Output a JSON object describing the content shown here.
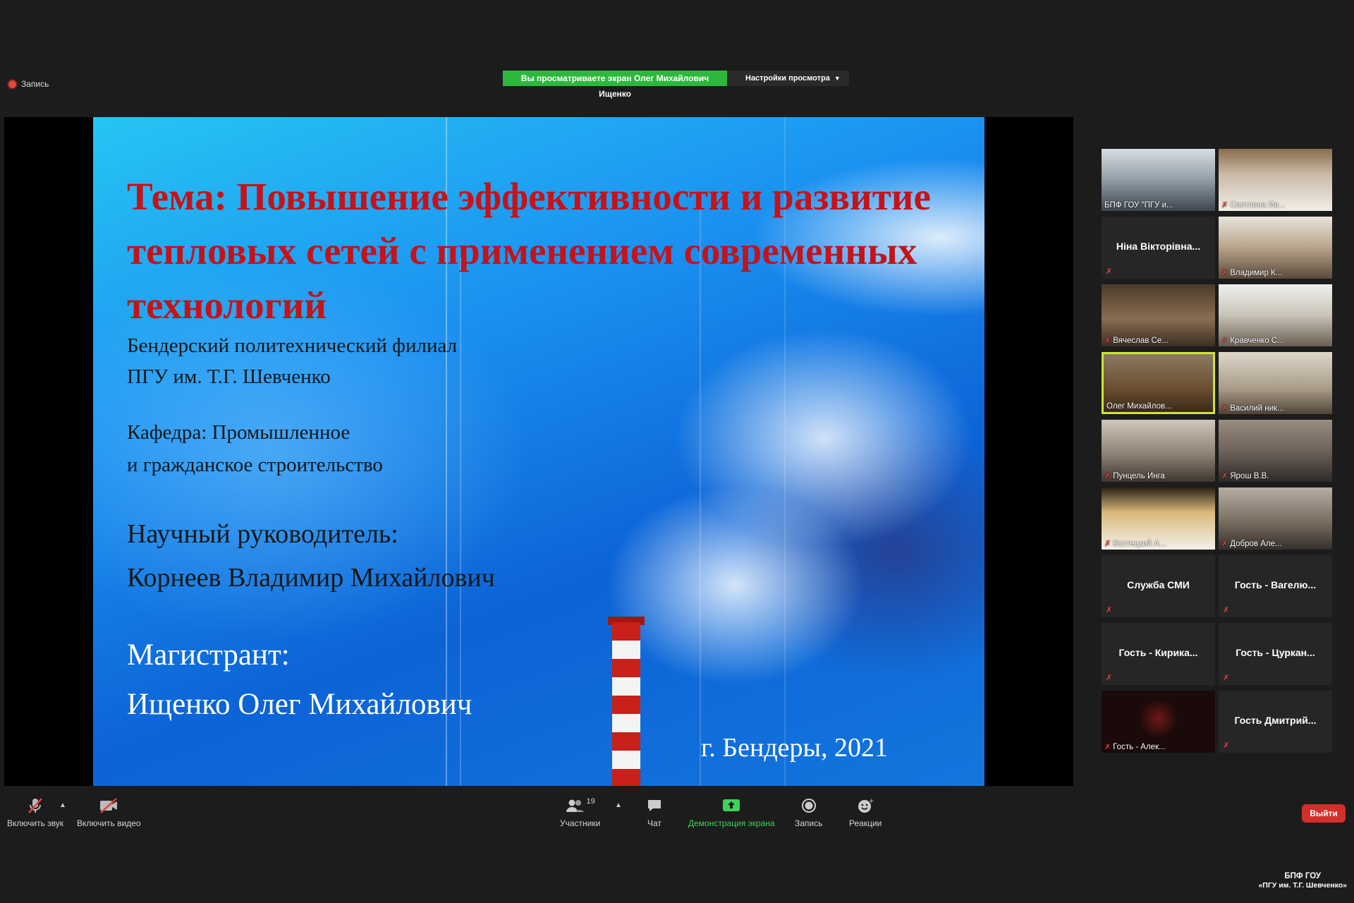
{
  "recording": {
    "label": "Запись"
  },
  "share_banner": {
    "text": "Вы просматриваете экран Олег Михайлович Ищенко",
    "view_options": "Настройки просмотра"
  },
  "slide": {
    "title": "Тема: Повышение эффективности и развитие тепловых сетей с применением современных технологий",
    "branch_line1": "Бендерский политехнический филиал",
    "branch_line2": "ПГУ им. Т.Г. Шевченко",
    "dept_line1": "Кафедра: Промышленное",
    "dept_line2": "и гражданское строительство",
    "supervisor_label": "Научный руководитель:",
    "supervisor_name": "Корнеев Владимир Михайлович",
    "author_label": "Магистрант:",
    "author_name": "Ищенко Олег Михайлович",
    "city_year": "г. Бендеры, 2021"
  },
  "participants": [
    {
      "name": "БПФ ГОУ \"ПГУ и...",
      "video": true,
      "muted": false,
      "active": false
    },
    {
      "name": "Светлана Ив...",
      "video": true,
      "muted": true,
      "active": false
    },
    {
      "name": "Ніна Вікторівна...",
      "video": false,
      "muted": true,
      "active": false
    },
    {
      "name": "Владимир К...",
      "video": true,
      "muted": true,
      "active": false
    },
    {
      "name": "Вячеслав Се...",
      "video": true,
      "muted": true,
      "active": false
    },
    {
      "name": "Кравченко С...",
      "video": true,
      "muted": true,
      "active": false
    },
    {
      "name": "Олег Михайлов...",
      "video": true,
      "muted": false,
      "active": true
    },
    {
      "name": "Василий ник...",
      "video": true,
      "muted": true,
      "active": false
    },
    {
      "name": "Пунцель Инга",
      "video": true,
      "muted": true,
      "active": false
    },
    {
      "name": "Ярош В.В.",
      "video": true,
      "muted": true,
      "active": false
    },
    {
      "name": "Костецкий А...",
      "video": true,
      "muted": true,
      "active": false
    },
    {
      "name": "Добров Але...",
      "video": true,
      "muted": true,
      "active": false
    },
    {
      "name": "Служба СМИ",
      "video": false,
      "muted": true,
      "active": false
    },
    {
      "name": "Гость - Вагелю...",
      "video": false,
      "muted": true,
      "active": false
    },
    {
      "name": "Гость - Кирика...",
      "video": false,
      "muted": true,
      "active": false
    },
    {
      "name": "Гость - Цуркан...",
      "video": false,
      "muted": true,
      "active": false
    },
    {
      "name": "Гость - Алек...",
      "video": true,
      "muted": true,
      "active": false
    },
    {
      "name": "Гость Дмитрий...",
      "video": false,
      "muted": true,
      "active": false
    }
  ],
  "toolbar": {
    "unmute": "Включить звук",
    "start_video": "Включить видео",
    "participants": "Участники",
    "participants_count": "19",
    "chat": "Чат",
    "share_screen": "Демонстрация экрана",
    "record": "Запись",
    "reactions": "Реакции",
    "leave": "Выйти"
  },
  "watermark": {
    "line1": "БПФ ГОУ",
    "line2": "«ПГУ им. Т.Г. Шевченко»"
  },
  "colors": {
    "share_green": "#2db83d",
    "leave_red": "#d1302b",
    "active_speaker": "#cfe33a"
  }
}
